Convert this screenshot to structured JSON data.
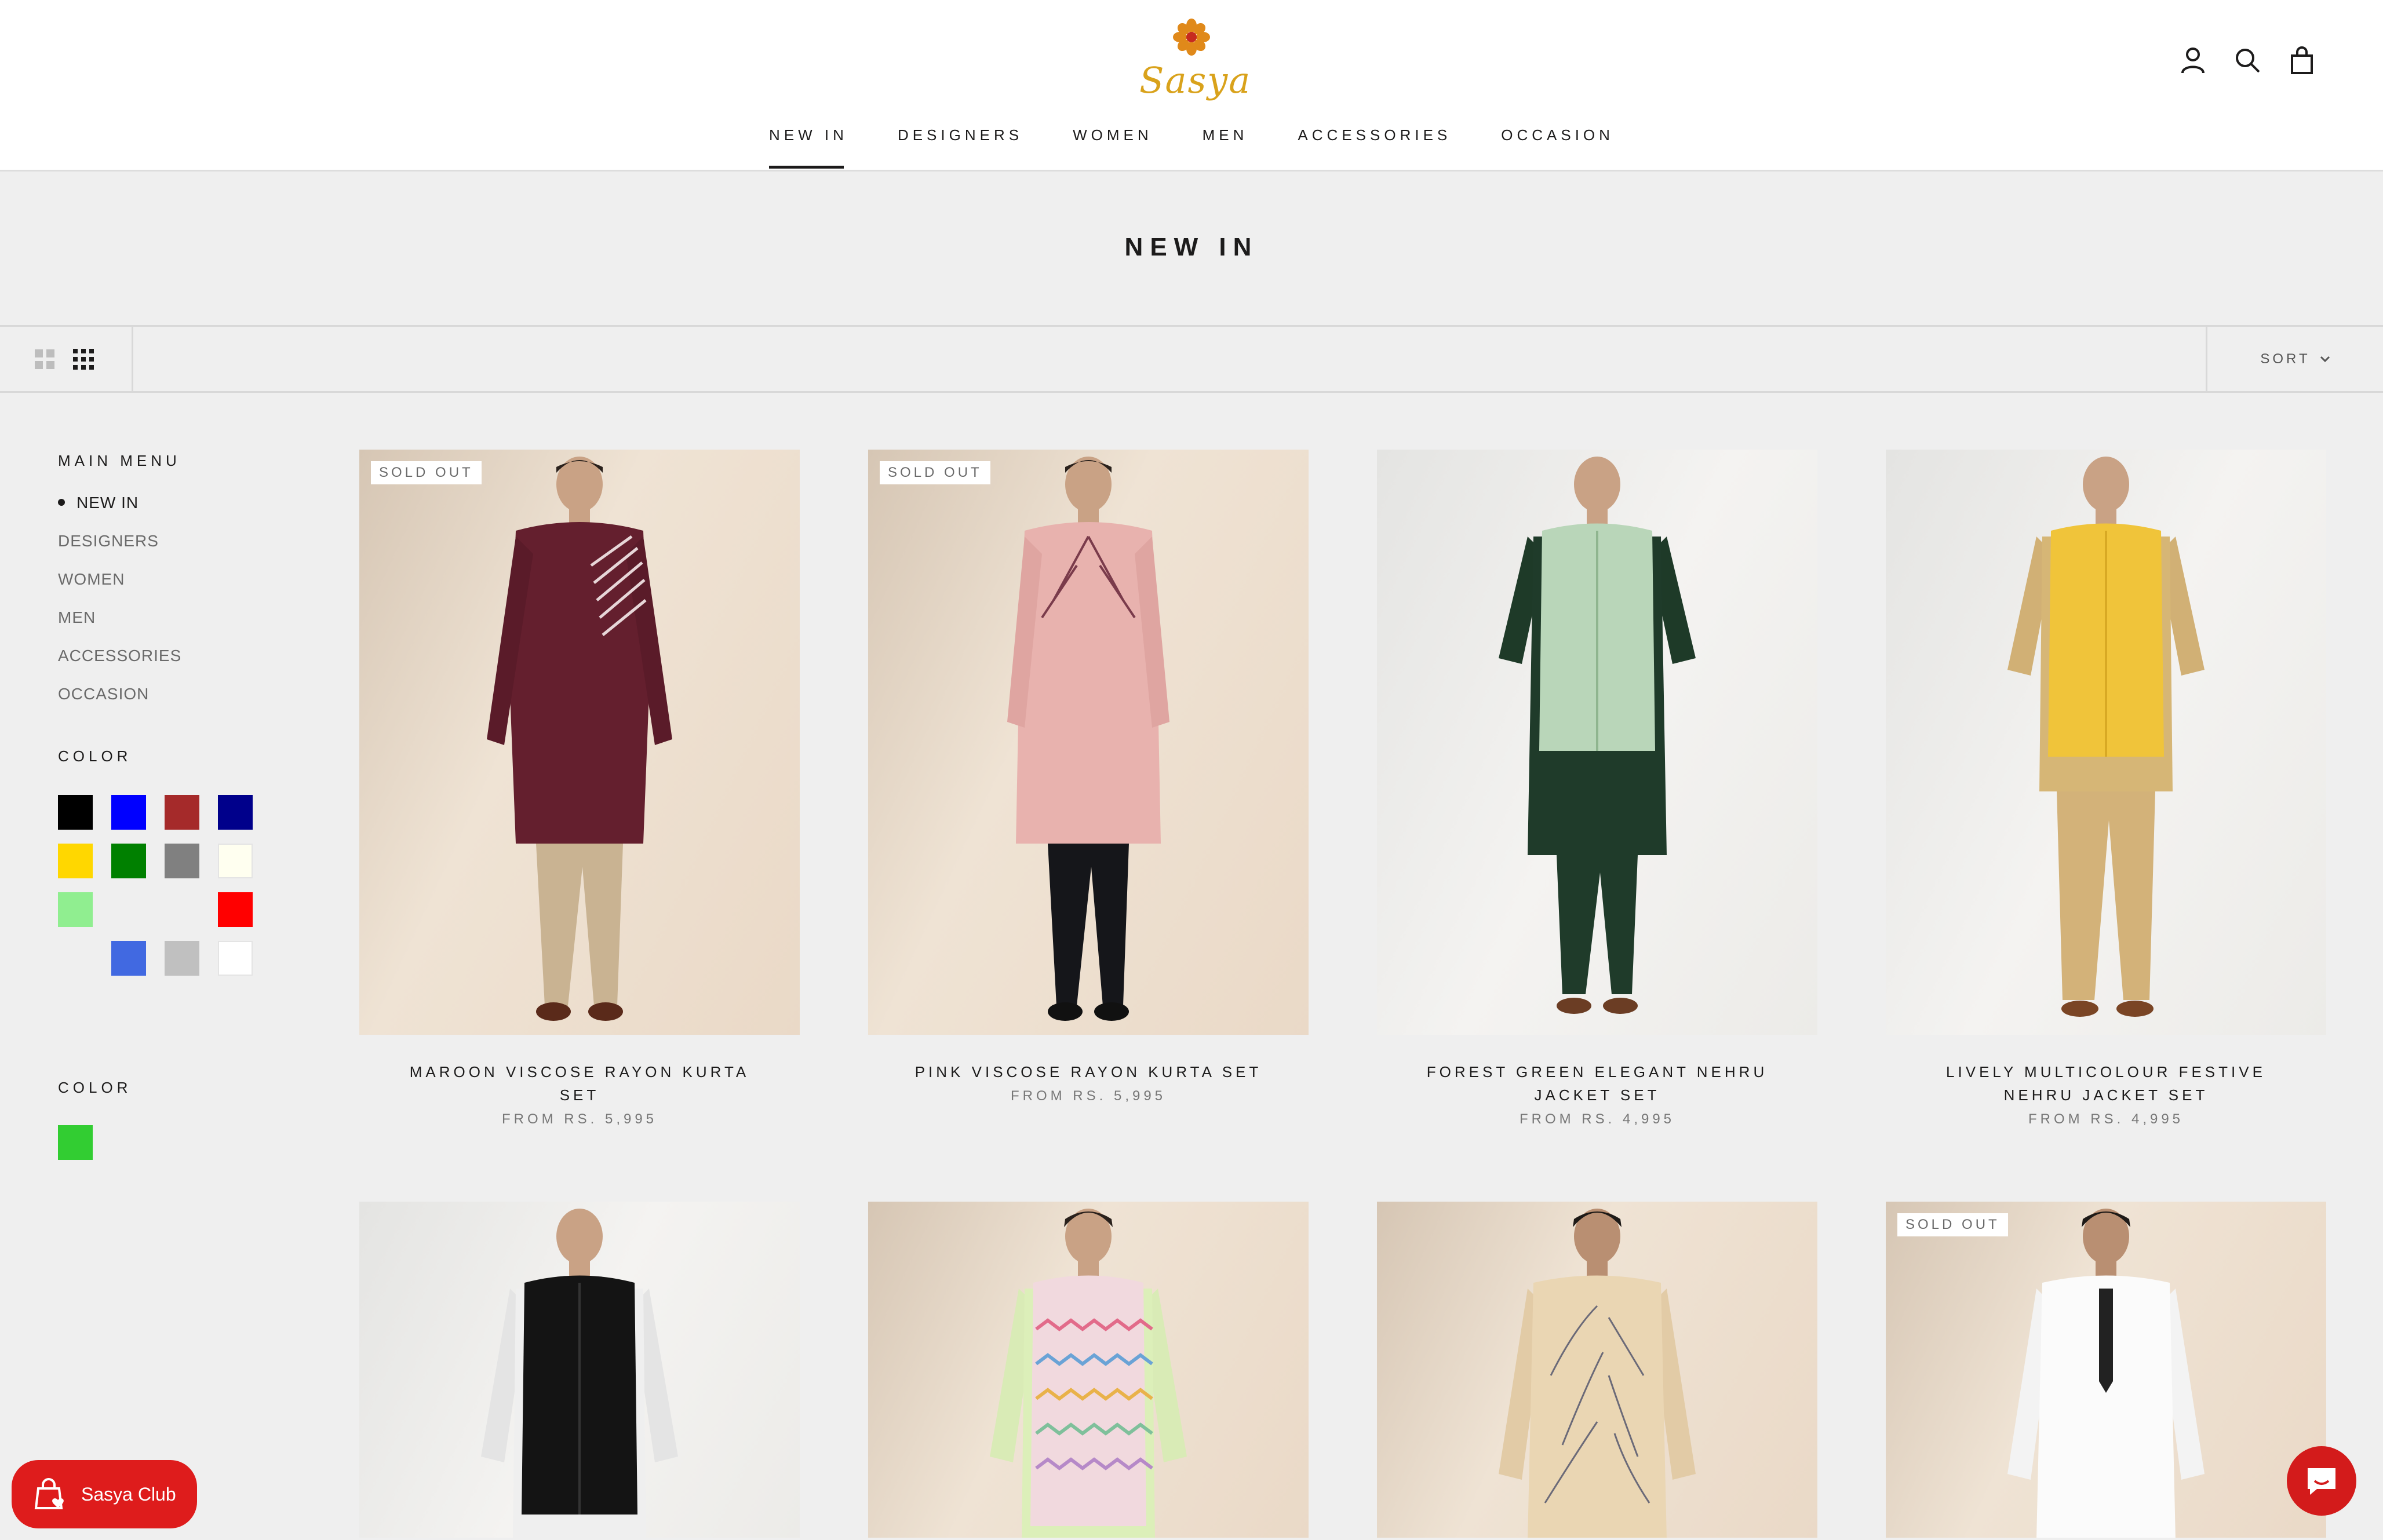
{
  "brand": {
    "name": "Sasya"
  },
  "header": {
    "icons": [
      "account-icon",
      "search-icon",
      "cart-icon"
    ]
  },
  "nav": {
    "items": [
      {
        "label": "NEW IN",
        "active": true
      },
      {
        "label": "DESIGNERS",
        "active": false
      },
      {
        "label": "WOMEN",
        "active": false
      },
      {
        "label": "MEN",
        "active": false
      },
      {
        "label": "ACCESSORIES",
        "active": false
      },
      {
        "label": "OCCASION",
        "active": false
      }
    ]
  },
  "page": {
    "title": "NEW IN"
  },
  "toolbar": {
    "sort_label": "SORT"
  },
  "sidebar": {
    "main_menu_heading": "MAIN MENU",
    "menu_items": [
      "NEW IN",
      "DESIGNERS",
      "WOMEN",
      "MEN",
      "ACCESSORIES",
      "OCCASION"
    ],
    "active_menu_item": "NEW IN",
    "color_heading_1": "COLOR",
    "color_swatches": [
      "#000000",
      "#0000ff",
      "#a52a2a",
      "#00008b",
      "#ffd700",
      "#008000",
      "#808080",
      "#fffff0",
      "#90ee90",
      "#ff0000",
      "#4169e1",
      "#c0c0c0",
      "#ffffff"
    ],
    "color_heading_2": "COLOR",
    "color_swatches_2": [
      "#32cd32"
    ]
  },
  "products": [
    {
      "title": "MAROON VISCOSE RAYON KURTA SET",
      "price": "FROM RS. 5,995",
      "sold_out": true
    },
    {
      "title": "PINK VISCOSE RAYON KURTA SET",
      "price": "FROM RS. 5,995",
      "sold_out": true
    },
    {
      "title": "FOREST GREEN ELEGANT NEHRU JACKET SET",
      "price": "FROM RS. 4,995",
      "sold_out": false
    },
    {
      "title": "LIVELY MULTICOLOUR FESTIVE NEHRU JACKET SET",
      "price": "FROM RS. 4,995",
      "sold_out": false
    },
    {
      "title": "",
      "price": "",
      "sold_out": false
    },
    {
      "title": "",
      "price": "",
      "sold_out": false
    },
    {
      "title": "",
      "price": "",
      "sold_out": false
    },
    {
      "title": "",
      "price": "",
      "sold_out": true
    }
  ],
  "badges": {
    "sold_out": "SOLD OUT"
  },
  "club": {
    "label": "Sasya Club"
  },
  "colors": {
    "accent": "#de1c1c",
    "brand_gold": "#d9a21b",
    "text": "#1c1b1b"
  }
}
